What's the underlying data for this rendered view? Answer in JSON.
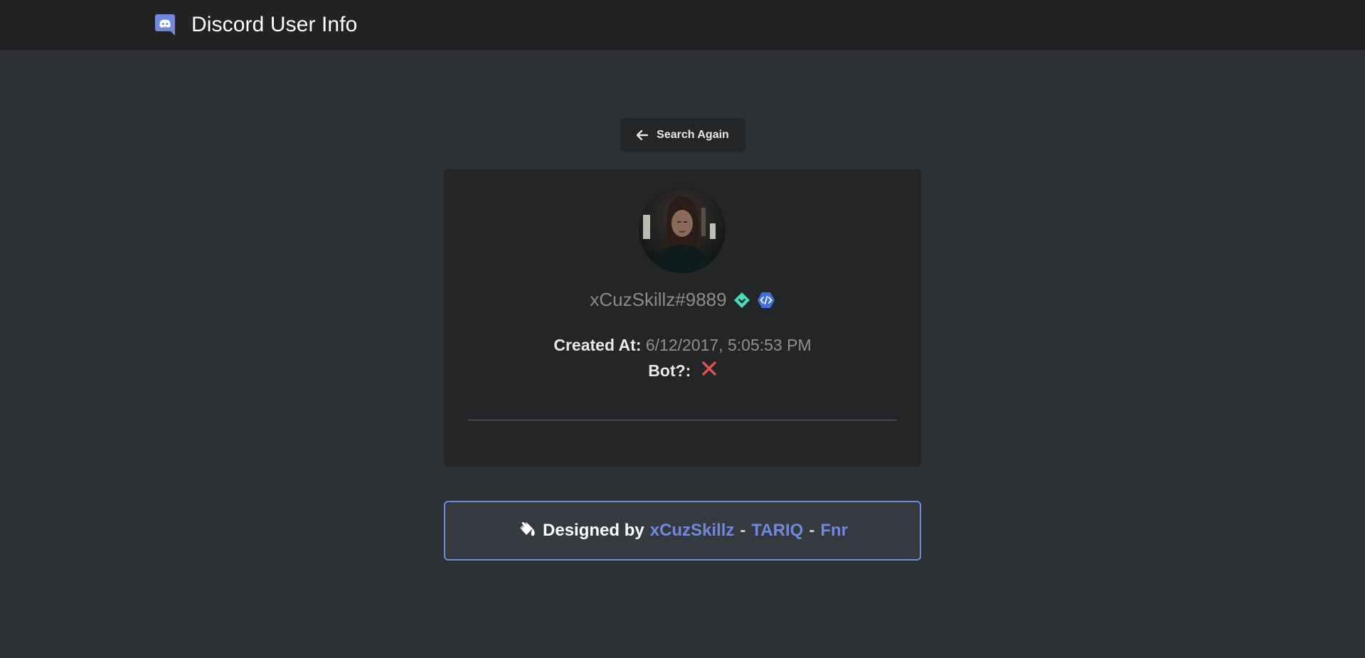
{
  "navbar": {
    "title": "Discord User Info",
    "icon": "discord-icon",
    "icon_color": "#7289da"
  },
  "search": {
    "label": "Search Again",
    "icon": "arrow-left-icon"
  },
  "profile": {
    "avatar": "avatar-photo",
    "username": "xCuzSkillz#9889",
    "badges": [
      "hypesquad-balance-icon",
      "verified-bot-developer-icon"
    ],
    "created_label": "Created At:",
    "created_value": "6/12/2017, 5:05:53 PM",
    "bot_label": "Bot?:",
    "bot_value_icon": "cross-icon",
    "bot_value_color": "#e05252"
  },
  "credit": {
    "prefix": "Designed by",
    "authors": [
      "xCuzSkillz",
      "TARIQ",
      "Fnr"
    ],
    "separator": "-",
    "link_color": "#7289da",
    "border_color": "#7289da"
  }
}
